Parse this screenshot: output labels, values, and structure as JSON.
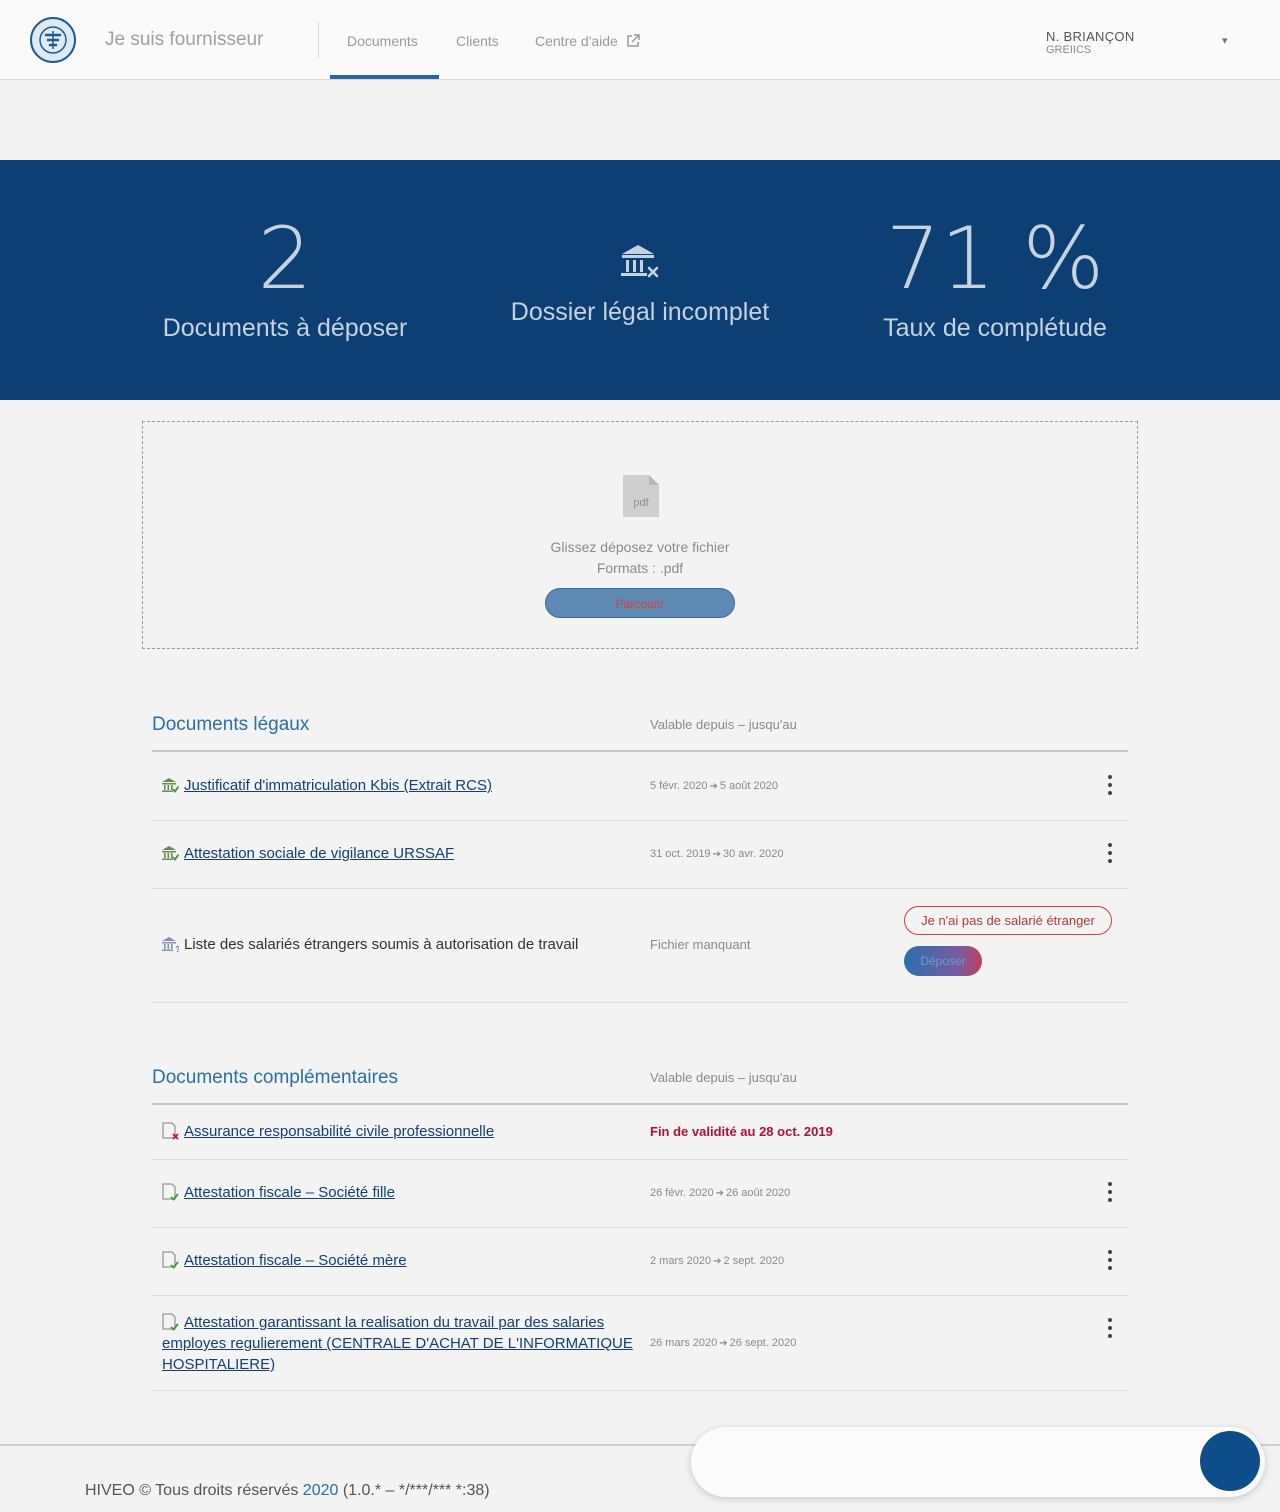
{
  "header": {
    "app_title": "Je suis fournisseur",
    "nav": [
      {
        "label": "Documents",
        "active": true
      },
      {
        "label": "Clients",
        "active": false
      },
      {
        "label": "Centre d'aide",
        "external": true
      }
    ],
    "user": {
      "name": "N. BRIANÇON",
      "company": "GREIICS"
    },
    "logo_icon": "hiveo-logo-icon",
    "accent_color": "#2166a5"
  },
  "stats": [
    {
      "value": "2",
      "label": "Documents à déposer"
    },
    {
      "icon": "bank-x-icon",
      "label": "Dossier légal incomplet"
    },
    {
      "value": "71 %",
      "label": "Taux de complétude"
    }
  ],
  "dropzone": {
    "icon": "pdf-file-icon",
    "line1": "Glissez déposez votre fichier",
    "line2": "Formats : .pdf",
    "browse_label": "Parcourir"
  },
  "legal": {
    "title": "Documents légaux",
    "col_header": "Valable depuis – jusqu'au",
    "rows": [
      {
        "icon": "bank-check-icon",
        "label": "Justificatif d'immatriculation Kbis (Extrait RCS)",
        "from": "5 févr. 2020",
        "to": "5 août 2020"
      },
      {
        "icon": "bank-check-icon",
        "label": "Attestation sociale de vigilance URSSAF",
        "from": "31 oct. 2019",
        "to": "30 avr. 2020"
      },
      {
        "icon": "bank-question-icon",
        "label": "Liste des salariés étrangers soumis à autorisation de travail",
        "status": "Fichier manquant",
        "action_outline": "Je n'ai pas de salarié étranger",
        "action_primary": "Déposer"
      }
    ]
  },
  "complementary": {
    "title": "Documents complémentaires",
    "col_header": "Valable depuis – jusqu'au",
    "rows": [
      {
        "icon": "doc-x-icon",
        "label": "Assurance responsabilité civile professionnelle",
        "status": "Fin de validité au 28 oct. 2019"
      },
      {
        "icon": "doc-check-icon",
        "label": "Attestation fiscale – Société fille",
        "from": "26 févr. 2020",
        "to": "26 août 2020"
      },
      {
        "icon": "doc-check-icon",
        "label": "Attestation fiscale – Société mère",
        "from": "2 mars 2020",
        "to": "2 sept. 2020"
      },
      {
        "icon": "doc-check-icon",
        "label": "Attestation garantissant la realisation du travail par des salaries employes regulierement (CENTRALE D'ACHAT DE L'INFORMATIQUE HOSPITALIERE)",
        "from": "26 mars 2020",
        "to": "26 sept. 2020"
      }
    ]
  },
  "footer": {
    "prefix": "HIVEO © Tous droits réservés",
    "year": "2020",
    "version": "(1.0.* – */***/*** *:38)"
  }
}
